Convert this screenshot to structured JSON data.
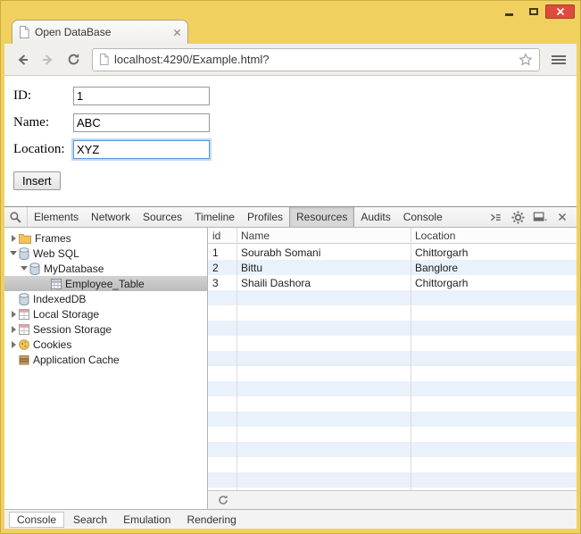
{
  "browser": {
    "tab_title": "Open DataBase",
    "url": "localhost:4290/Example.html?"
  },
  "page": {
    "fields": [
      {
        "label": "ID:",
        "value": "1"
      },
      {
        "label": "Name:",
        "value": "ABC"
      },
      {
        "label": "Location:",
        "value": "XYZ"
      }
    ],
    "insert_label": "Insert"
  },
  "devtools": {
    "tabs": [
      "Elements",
      "Network",
      "Sources",
      "Timeline",
      "Profiles",
      "Resources",
      "Audits",
      "Console"
    ],
    "selected_tab": "Resources",
    "tree": [
      {
        "label": "Frames",
        "icon": "folder-icon"
      },
      {
        "label": "Web SQL",
        "icon": "database-icon"
      },
      {
        "label": "MyDatabase",
        "icon": "database-icon"
      },
      {
        "label": "Employee_Table",
        "icon": "table-icon",
        "selected": true
      },
      {
        "label": "IndexedDB",
        "icon": "database-icon"
      },
      {
        "label": "Local Storage",
        "icon": "storage-icon"
      },
      {
        "label": "Session Storage",
        "icon": "storage-icon"
      },
      {
        "label": "Cookies",
        "icon": "cookie-icon"
      },
      {
        "label": "Application Cache",
        "icon": "appcache-icon"
      }
    ],
    "grid": {
      "columns": [
        "id",
        "Name",
        "Location"
      ],
      "rows": [
        [
          "1",
          "Sourabh Somani",
          "Chittorgarh"
        ],
        [
          "2",
          "Bittu",
          "Banglore"
        ],
        [
          "3",
          "Shaili Dashora",
          "Chittorgarh"
        ]
      ]
    },
    "footer_tabs": [
      "Console",
      "Search",
      "Emulation",
      "Rendering"
    ]
  },
  "colors": {
    "frame_yellow": "#f0d160",
    "close_red": "#de4a3e",
    "row_stripe_blue": "#e9f1fb",
    "selection_gray": "#c6c6c6"
  }
}
